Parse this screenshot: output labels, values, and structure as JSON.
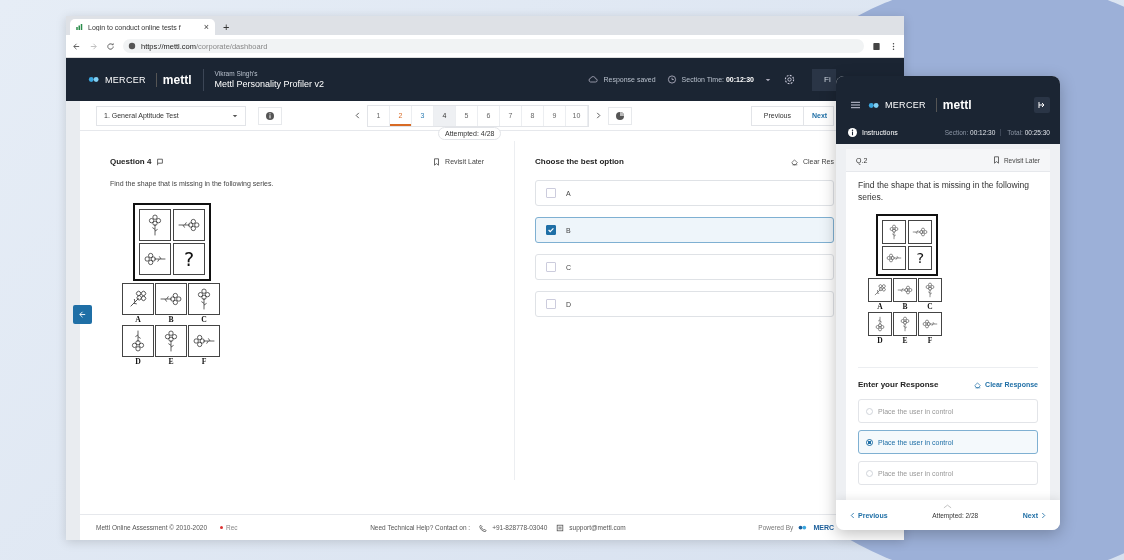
{
  "browser": {
    "tab_title": "Login to conduct online tests f",
    "tab_close": "×",
    "new_tab": "+",
    "url_host": "https://mettl.com",
    "url_path": "/corporate/dashboard"
  },
  "header": {
    "brand": "MERCER",
    "product": "mettl",
    "owner": "Vikram Singh's",
    "test_name": "Mettl Personality Profiler v2",
    "save_status": "Response saved",
    "section_time_label": "Section Time:",
    "section_time": "00:12:30",
    "finish_button": "Fi"
  },
  "toolbar": {
    "section_select": "1.  General Aptitude Test",
    "pages": [
      {
        "label": "1",
        "kind": "plain",
        "selected": false
      },
      {
        "label": "2",
        "kind": "plain",
        "selected": true
      },
      {
        "label": "3",
        "kind": "answered",
        "selected": false
      },
      {
        "label": "4",
        "kind": "visited",
        "selected": false
      },
      {
        "label": "5",
        "kind": "plain",
        "selected": false
      },
      {
        "label": "6",
        "kind": "plain",
        "selected": false
      },
      {
        "label": "7",
        "kind": "plain",
        "selected": false
      },
      {
        "label": "8",
        "kind": "plain",
        "selected": false
      },
      {
        "label": "9",
        "kind": "plain",
        "selected": false
      },
      {
        "label": "10",
        "kind": "plain",
        "selected": false
      }
    ],
    "attempted": "Attempted: 4/28",
    "previous": "Previous",
    "next": "Next"
  },
  "question": {
    "title": "Question 4",
    "revisit": "Revisit Later",
    "text": "Find the shape that is missing in the following series.",
    "figure": {
      "question_mark": "?",
      "options": [
        "A",
        "B",
        "C",
        "D",
        "E",
        "F"
      ]
    }
  },
  "answer": {
    "title": "Choose the best option",
    "clear": "Clear Res",
    "options": [
      {
        "label": "A",
        "selected": false
      },
      {
        "label": "B",
        "selected": true
      },
      {
        "label": "C",
        "selected": false
      },
      {
        "label": "D",
        "selected": false
      }
    ]
  },
  "footer": {
    "copyright": "Mettl Online Assessment © 2010-2020",
    "rec": "Rec",
    "help": "Need Technical Help? Contact on :",
    "phone": "+91-828778-03040",
    "email": "support@mettl.com",
    "powered": "Powered By",
    "powered_brand": "MERC"
  },
  "mobile": {
    "brand": "MERCER",
    "product": "mettl",
    "instructions": "Instructions",
    "section_label": "Section:",
    "section_time": "00:12:30",
    "total_label": "Total:",
    "total_time": "00:25:30",
    "question_no": "Q.2",
    "revisit": "Revisit Later",
    "text": "Find the shape that is missing in the following series.",
    "figure": {
      "question_mark": "?",
      "options": [
        "A",
        "B",
        "C",
        "D",
        "E",
        "F"
      ]
    },
    "response_title": "Enter your Response",
    "clear": "Clear Response",
    "options": [
      {
        "label": "Place the user in control",
        "selected": false
      },
      {
        "label": "Place the user in control",
        "selected": true
      },
      {
        "label": "Place the user in control",
        "selected": false
      }
    ],
    "previous": "Previous",
    "attempted": "Attempted: 2/28",
    "next": "Next"
  }
}
